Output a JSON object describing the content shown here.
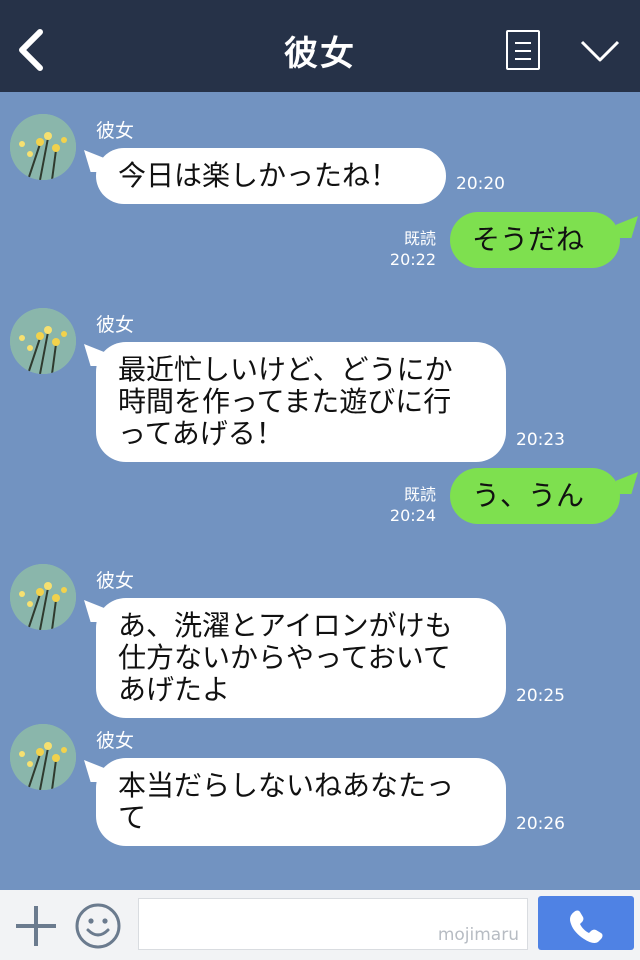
{
  "header": {
    "title": "彼女"
  },
  "messages": [
    {
      "from": "them",
      "sender": "彼女",
      "text": "今日は楽しかったね！",
      "time": "20:20"
    },
    {
      "from": "me",
      "text": "そうだね",
      "read": "既読",
      "time": "20:22"
    },
    {
      "from": "them",
      "sender": "彼女",
      "text": "最近忙しいけど、どうにか\n時間を作ってまた遊びに行\nってあげる！",
      "time": "20:23"
    },
    {
      "from": "me",
      "text": "う、うん",
      "read": "既読",
      "time": "20:24"
    },
    {
      "from": "them",
      "sender": "彼女",
      "text": "あ、洗濯とアイロンがけも\n仕方ないからやっておいて\nあげたよ",
      "time": "20:25"
    },
    {
      "from": "them",
      "sender": "彼女",
      "text": "本当だらしないねあなたっ\nて",
      "time": "20:26"
    }
  ],
  "composer": {
    "watermark": "mojimaru"
  },
  "colors": {
    "header_bg": "#263248",
    "chat_bg": "#7293c1",
    "outgoing_bubble": "#7ee04f",
    "incoming_bubble": "#ffffff",
    "send_button": "#4f82e4"
  },
  "icons": {
    "back": "chevron-left-icon",
    "menu": "list-icon",
    "collapse": "chevron-down-icon",
    "add": "plus-icon",
    "emoji": "smiley-icon",
    "call": "phone-icon"
  }
}
